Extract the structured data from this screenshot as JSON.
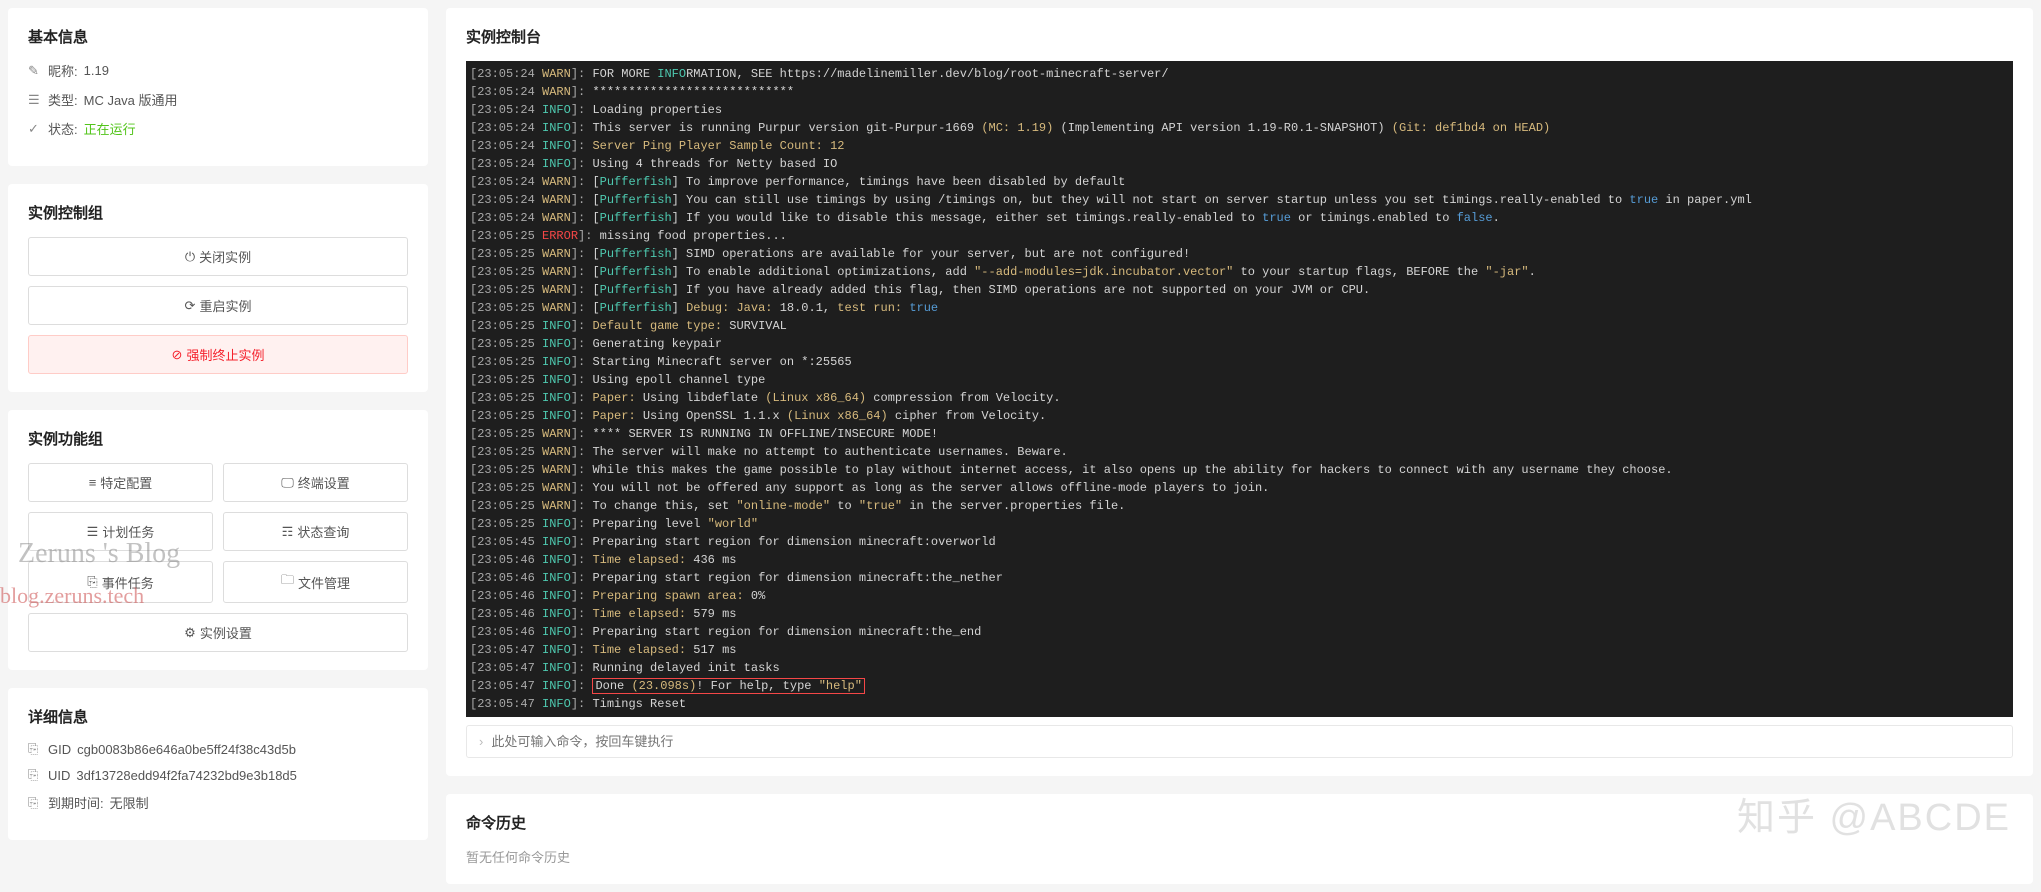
{
  "basic_info": {
    "title": "基本信息",
    "nick_label": "昵称:",
    "nick_value": "1.19",
    "type_label": "类型:",
    "type_value": "MC Java 版通用",
    "status_label": "状态:",
    "status_value": "正在运行"
  },
  "control_group": {
    "title": "实例控制组",
    "shutdown": "关闭实例",
    "restart": "重启实例",
    "kill": "强制终止实例"
  },
  "func_group": {
    "title": "实例功能组",
    "specific": "特定配置",
    "terminal": "终端设置",
    "schedule": "计划任务",
    "status": "状态查询",
    "events": "事件任务",
    "files": "文件管理",
    "settings": "实例设置"
  },
  "detail_info": {
    "title": "详细信息",
    "gid_label": "GID",
    "gid_value": "cgb0083b86e646a0be5ff24f38c43d5b",
    "uid_label": "UID",
    "uid_value": "3df13728edd94f2fa74232bd9e3b18d5",
    "expire_label": "到期时间:",
    "expire_value": "无限制"
  },
  "console": {
    "title": "实例控制台",
    "input_placeholder": "此处可输入命令，按回车键执行"
  },
  "history": {
    "title": "命令历史",
    "empty": "暂无任何命令历史"
  },
  "watermarks": {
    "w1": "Zeruns 's Blog",
    "w2": "blog.zeruns.tech",
    "w3": "知乎 @ABCDE"
  },
  "log": [
    {
      "t": "23:05:24",
      "lv": "WARN",
      "seg": [
        {
          "c": "d",
          "v": "FOR MORE "
        },
        {
          "c": "info",
          "v": "INFO"
        },
        {
          "c": "d",
          "v": "RMATION, SEE https://madelinemiller.dev/blog/root-minecraft-server/"
        }
      ]
    },
    {
      "t": "23:05:24",
      "lv": "WARN",
      "seg": [
        {
          "c": "d",
          "v": "****************************"
        }
      ]
    },
    {
      "t": "23:05:24",
      "lv": "INFO",
      "seg": [
        {
          "c": "d",
          "v": "Loading properties"
        }
      ]
    },
    {
      "t": "23:05:24",
      "lv": "INFO",
      "seg": [
        {
          "c": "d",
          "v": "This server is running Purpur version git-Purpur-1669 "
        },
        {
          "c": "gold",
          "v": "(MC: 1.19)"
        },
        {
          "c": "d",
          "v": " (Implementing API version 1.19-R0.1-SNAPSHOT) "
        },
        {
          "c": "gold",
          "v": "(Git: def1bd4 on HEAD)"
        }
      ]
    },
    {
      "t": "23:05:24",
      "lv": "INFO",
      "seg": [
        {
          "c": "gold",
          "v": "Server Ping Player Sample Count: 12"
        }
      ]
    },
    {
      "t": "23:05:24",
      "lv": "INFO",
      "seg": [
        {
          "c": "d",
          "v": "Using 4 threads for Netty based IO"
        }
      ]
    },
    {
      "t": "23:05:24",
      "lv": "WARN",
      "seg": [
        {
          "c": "d",
          "v": "["
        },
        {
          "c": "src",
          "v": "Pufferfish"
        },
        {
          "c": "d",
          "v": "] To improve performance, timings have been disabled by default"
        }
      ]
    },
    {
      "t": "23:05:24",
      "lv": "WARN",
      "seg": [
        {
          "c": "d",
          "v": "["
        },
        {
          "c": "src",
          "v": "Pufferfish"
        },
        {
          "c": "d",
          "v": "] You can still use timings by using /timings on, but they will not start on server startup unless you set timings.really-enabled to "
        },
        {
          "c": "true",
          "v": "true"
        },
        {
          "c": "d",
          "v": " in paper.yml"
        }
      ]
    },
    {
      "t": "23:05:24",
      "lv": "WARN",
      "seg": [
        {
          "c": "d",
          "v": "["
        },
        {
          "c": "src",
          "v": "Pufferfish"
        },
        {
          "c": "d",
          "v": "] If you would like to disable this message, either set timings.really-enabled to "
        },
        {
          "c": "true",
          "v": "true"
        },
        {
          "c": "d",
          "v": " or timings.enabled to "
        },
        {
          "c": "true",
          "v": "false"
        },
        {
          "c": "d",
          "v": "."
        }
      ]
    },
    {
      "t": "23:05:25",
      "lv": "ERROR",
      "seg": [
        {
          "c": "d",
          "v": "missing food properties..."
        }
      ]
    },
    {
      "t": "23:05:25",
      "lv": "WARN",
      "seg": [
        {
          "c": "d",
          "v": "["
        },
        {
          "c": "src",
          "v": "Pufferfish"
        },
        {
          "c": "d",
          "v": "] SIMD operations are available for your server, but are not configured!"
        }
      ]
    },
    {
      "t": "23:05:25",
      "lv": "WARN",
      "seg": [
        {
          "c": "d",
          "v": "["
        },
        {
          "c": "src",
          "v": "Pufferfish"
        },
        {
          "c": "d",
          "v": "] To enable additional optimizations, add "
        },
        {
          "c": "str",
          "v": "\"--add-modules=jdk.incubator.vector\""
        },
        {
          "c": "d",
          "v": " to your startup flags, BEFORE the "
        },
        {
          "c": "str",
          "v": "\"-jar\""
        },
        {
          "c": "d",
          "v": "."
        }
      ]
    },
    {
      "t": "23:05:25",
      "lv": "WARN",
      "seg": [
        {
          "c": "d",
          "v": "["
        },
        {
          "c": "src",
          "v": "Pufferfish"
        },
        {
          "c": "d",
          "v": "] If you have already added this flag, then SIMD operations are not supported on your JVM or CPU."
        }
      ]
    },
    {
      "t": "23:05:25",
      "lv": "WARN",
      "seg": [
        {
          "c": "d",
          "v": "["
        },
        {
          "c": "src",
          "v": "Pufferfish"
        },
        {
          "c": "d",
          "v": "] "
        },
        {
          "c": "debug",
          "v": "Debug: Java: "
        },
        {
          "c": "d",
          "v": "18.0.1, "
        },
        {
          "c": "debug",
          "v": "test run:"
        },
        {
          "c": "d",
          "v": " "
        },
        {
          "c": "true",
          "v": "true"
        }
      ]
    },
    {
      "t": "23:05:25",
      "lv": "INFO",
      "seg": [
        {
          "c": "gold",
          "v": "Default game type: "
        },
        {
          "c": "d",
          "v": "SURVIVAL"
        }
      ]
    },
    {
      "t": "23:05:25",
      "lv": "INFO",
      "seg": [
        {
          "c": "d",
          "v": "Generating keypair"
        }
      ]
    },
    {
      "t": "23:05:25",
      "lv": "INFO",
      "seg": [
        {
          "c": "d",
          "v": "Starting Minecraft server on *:25565"
        }
      ]
    },
    {
      "t": "23:05:25",
      "lv": "INFO",
      "seg": [
        {
          "c": "d",
          "v": "Using epoll channel type"
        }
      ]
    },
    {
      "t": "23:05:25",
      "lv": "INFO",
      "seg": [
        {
          "c": "gold",
          "v": "Paper: "
        },
        {
          "c": "d",
          "v": "Using libdeflate "
        },
        {
          "c": "gold",
          "v": "(Linux x86_64)"
        },
        {
          "c": "d",
          "v": " compression from Velocity."
        }
      ]
    },
    {
      "t": "23:05:25",
      "lv": "INFO",
      "seg": [
        {
          "c": "gold",
          "v": "Paper: "
        },
        {
          "c": "d",
          "v": "Using OpenSSL 1.1.x "
        },
        {
          "c": "gold",
          "v": "(Linux x86_64)"
        },
        {
          "c": "d",
          "v": " cipher from Velocity."
        }
      ]
    },
    {
      "t": "23:05:25",
      "lv": "WARN",
      "seg": [
        {
          "c": "d",
          "v": "**** SERVER IS RUNNING IN OFFLINE/INSECURE MODE!"
        }
      ]
    },
    {
      "t": "23:05:25",
      "lv": "WARN",
      "seg": [
        {
          "c": "d",
          "v": "The server will make no attempt to authenticate usernames. Beware."
        }
      ]
    },
    {
      "t": "23:05:25",
      "lv": "WARN",
      "seg": [
        {
          "c": "d",
          "v": "While this makes the game possible to play without internet access, it also opens up the ability for hackers to connect with any username they choose."
        }
      ]
    },
    {
      "t": "23:05:25",
      "lv": "WARN",
      "seg": [
        {
          "c": "d",
          "v": "You will not be offered any support as long as the server allows offline-mode players to join."
        }
      ]
    },
    {
      "t": "23:05:25",
      "lv": "WARN",
      "seg": [
        {
          "c": "d",
          "v": "To change this, set "
        },
        {
          "c": "str",
          "v": "\"online-mode\""
        },
        {
          "c": "d",
          "v": " to "
        },
        {
          "c": "str",
          "v": "\"true\""
        },
        {
          "c": "d",
          "v": " in the server.properties file."
        }
      ]
    },
    {
      "t": "23:05:25",
      "lv": "INFO",
      "seg": [
        {
          "c": "d",
          "v": "Preparing level "
        },
        {
          "c": "str",
          "v": "\"world\""
        }
      ]
    },
    {
      "t": "23:05:45",
      "lv": "INFO",
      "seg": [
        {
          "c": "d",
          "v": "Preparing start region for dimension minecraft:overworld"
        }
      ]
    },
    {
      "t": "23:05:46",
      "lv": "INFO",
      "seg": [
        {
          "c": "gold",
          "v": "Time elapsed: "
        },
        {
          "c": "d",
          "v": "436 ms"
        }
      ]
    },
    {
      "t": "23:05:46",
      "lv": "INFO",
      "seg": [
        {
          "c": "d",
          "v": "Preparing start region for dimension minecraft:the_nether"
        }
      ]
    },
    {
      "t": "23:05:46",
      "lv": "INFO",
      "seg": [
        {
          "c": "gold",
          "v": "Preparing spawn area: "
        },
        {
          "c": "d",
          "v": "0%"
        }
      ]
    },
    {
      "t": "23:05:46",
      "lv": "INFO",
      "seg": [
        {
          "c": "gold",
          "v": "Time elapsed: "
        },
        {
          "c": "d",
          "v": "579 ms"
        }
      ]
    },
    {
      "t": "23:05:46",
      "lv": "INFO",
      "seg": [
        {
          "c": "d",
          "v": "Preparing start region for dimension minecraft:the_end"
        }
      ]
    },
    {
      "t": "23:05:47",
      "lv": "INFO",
      "seg": [
        {
          "c": "gold",
          "v": "Time elapsed: "
        },
        {
          "c": "d",
          "v": "517 ms"
        }
      ]
    },
    {
      "t": "23:05:47",
      "lv": "INFO",
      "seg": [
        {
          "c": "d",
          "v": "Running delayed init tasks"
        }
      ]
    },
    {
      "t": "23:05:47",
      "lv": "INFO",
      "seg": [
        {
          "c": "d",
          "v": "Done "
        },
        {
          "c": "gold",
          "v": "(23.098s)"
        },
        {
          "c": "d",
          "v": "! For help, type "
        },
        {
          "c": "str",
          "v": "\"help\""
        }
      ],
      "box": true
    },
    {
      "t": "23:05:47",
      "lv": "INFO",
      "seg": [
        {
          "c": "d",
          "v": "Timings Reset"
        }
      ]
    }
  ]
}
